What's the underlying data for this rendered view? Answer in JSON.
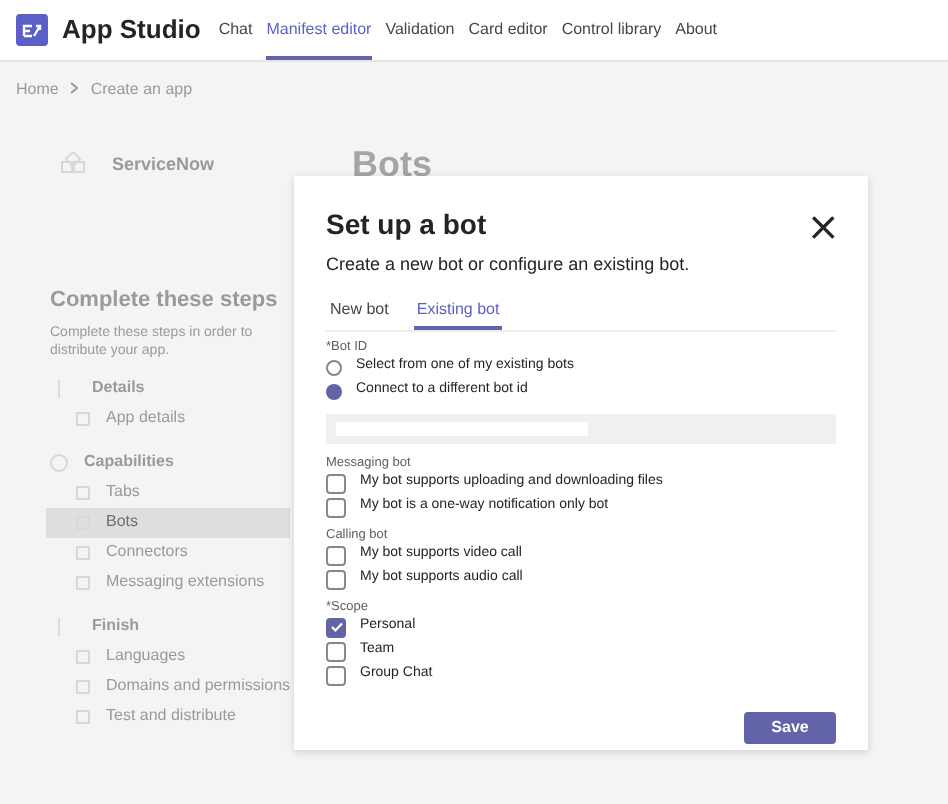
{
  "app": {
    "title": "App Studio"
  },
  "nav_tabs": [
    {
      "label": "Chat",
      "selected": false
    },
    {
      "label": "Manifest editor",
      "selected": true
    },
    {
      "label": "Validation",
      "selected": false
    },
    {
      "label": "Card editor",
      "selected": false
    },
    {
      "label": "Control library",
      "selected": false
    },
    {
      "label": "About",
      "selected": false
    }
  ],
  "breadcrumb": [
    "Home",
    "Create an app"
  ],
  "app_card": {
    "name": "ServiceNow"
  },
  "page_title": "Bots",
  "steps": {
    "title": "Complete these steps",
    "description": "Complete these steps in order to distribute your app.",
    "sections": [
      {
        "label": "Details",
        "kind": "number",
        "children": [
          {
            "label": "App details",
            "selected": false
          }
        ]
      },
      {
        "label": "Capabilities",
        "kind": "circle",
        "children": [
          {
            "label": "Tabs",
            "selected": false
          },
          {
            "label": "Bots",
            "selected": true
          },
          {
            "label": "Connectors",
            "selected": false
          },
          {
            "label": "Messaging extensions",
            "selected": false
          }
        ]
      },
      {
        "label": "Finish",
        "kind": "number",
        "children": [
          {
            "label": "Languages",
            "selected": false
          },
          {
            "label": "Domains and permissions",
            "selected": false
          },
          {
            "label": "Test and distribute",
            "selected": false
          }
        ]
      }
    ]
  },
  "dialog": {
    "title": "Set up a bot",
    "subtitle": "Create a new bot or configure an existing bot.",
    "close": "×",
    "tabs": [
      {
        "label": "New bot",
        "selected": false
      },
      {
        "label": "Existing bot",
        "selected": true
      }
    ],
    "groups": [
      {
        "label": "*Bot ID",
        "kind": "radio",
        "options": [
          {
            "label": "Select from one of my existing bots",
            "selected": false
          },
          {
            "label": "Connect to a different bot id",
            "selected": true
          }
        ]
      },
      {
        "kind": "field"
      },
      {
        "label": "Messaging bot",
        "kind": "checkbox",
        "options": [
          {
            "label": "My bot supports uploading and downloading files",
            "checked": false
          },
          {
            "label": "My bot is a one-way notification only bot",
            "checked": false
          }
        ]
      },
      {
        "label": "Calling bot",
        "kind": "checkbox",
        "options": [
          {
            "label": "My bot supports video call",
            "checked": false
          },
          {
            "label": "My bot supports audio call",
            "checked": false
          }
        ]
      },
      {
        "label": "*Scope",
        "kind": "checkbox",
        "options": [
          {
            "label": "Personal",
            "checked": true
          },
          {
            "label": "Team",
            "checked": false
          },
          {
            "label": "Group Chat",
            "checked": false
          }
        ]
      }
    ],
    "save": "Save"
  }
}
